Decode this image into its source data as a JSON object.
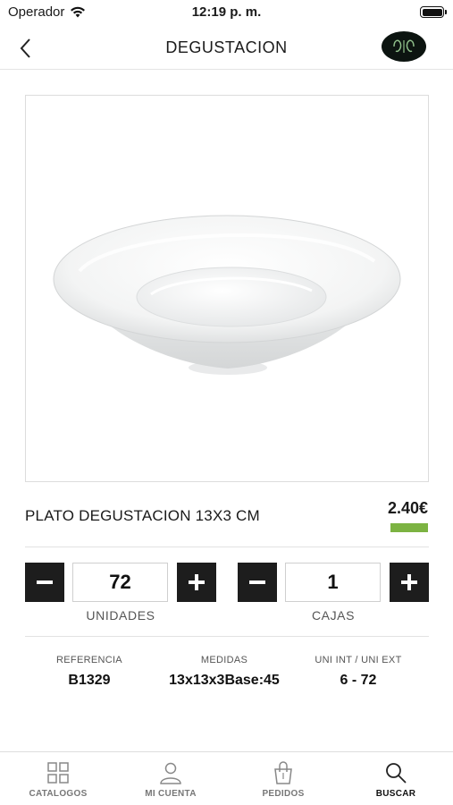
{
  "status_bar": {
    "carrier": "Operador",
    "time": "12:19 p. m."
  },
  "nav": {
    "title": "DEGUSTACION",
    "back_icon": "chevron-left-icon",
    "logo_icon": "brand-logo"
  },
  "product": {
    "name": "PLATO DEGUSTACION 13X3 CM",
    "price": "2.40€",
    "price_accent_color": "#7cb342",
    "image_icon": "white-porcelain-tasting-plate"
  },
  "quantity": {
    "units_value": "72",
    "units_label": "UNIDADES",
    "boxes_value": "1",
    "boxes_label": "CAJAS"
  },
  "specs": [
    {
      "label": "REFERENCIA",
      "value": "B1329"
    },
    {
      "label": "MEDIDAS",
      "value": "13x13x3Base:45"
    },
    {
      "label": "UNI INT / UNI EXT",
      "value": "6 - 72"
    }
  ],
  "tabs": [
    {
      "label": "CATALOGOS",
      "icon": "grid-icon",
      "active": false
    },
    {
      "label": "MI CUENTA",
      "icon": "user-icon",
      "active": false
    },
    {
      "label": "PEDIDOS",
      "icon": "shopping-bag-icon",
      "active": false
    },
    {
      "label": "BUSCAR",
      "icon": "search-icon",
      "active": true
    }
  ]
}
